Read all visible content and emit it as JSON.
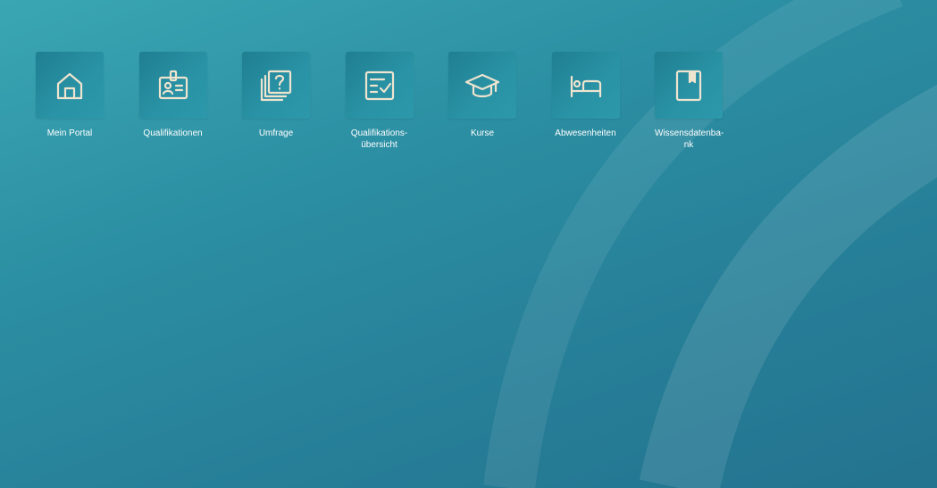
{
  "theme": {
    "background": "#2c8fa3",
    "tile_color": "#248a9d",
    "icon_color": "#efe4cf",
    "label_color": "#ffffff"
  },
  "tiles": [
    {
      "label": "Mein Portal",
      "icon": "home-icon"
    },
    {
      "label": "Qualifikationen",
      "icon": "id-badge-icon"
    },
    {
      "label": "Umfrage",
      "icon": "survey-question-icon"
    },
    {
      "label": "Qualifikations-\nübersicht",
      "icon": "checklist-icon"
    },
    {
      "label": "Kurse",
      "icon": "graduation-cap-icon"
    },
    {
      "label": "Abwesenheiten",
      "icon": "bed-icon"
    },
    {
      "label": "Wissensdatenba-\nnk",
      "icon": "book-icon"
    }
  ]
}
